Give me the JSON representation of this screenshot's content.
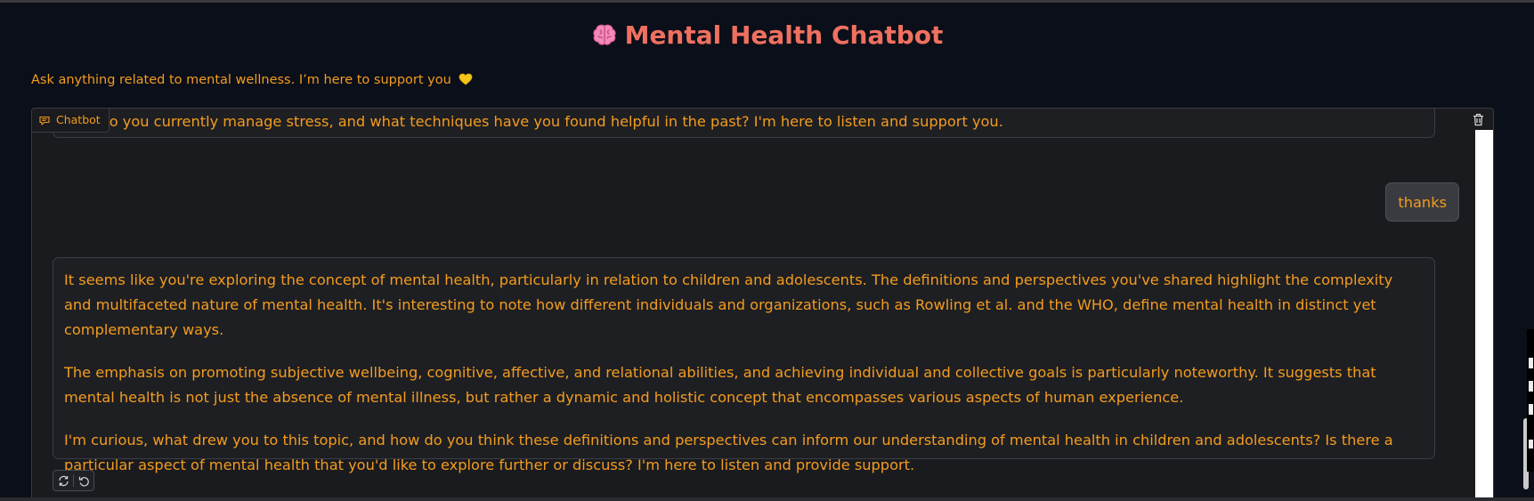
{
  "app": {
    "title": "Mental Health Chatbot",
    "title_icon": "brain-icon",
    "subtitle": "Ask anything related to mental wellness. I’m here to support you",
    "subtitle_icon": "yellow-heart-icon"
  },
  "chatbot": {
    "label": "Chatbot",
    "label_icon": "chat-icon",
    "clear_icon": "trash-icon",
    "messages": [
      {
        "role": "bot",
        "paragraphs": [
          "How do you currently manage stress, and what techniques have you found helpful in the past? I'm here to listen and support you."
        ]
      },
      {
        "role": "user",
        "text": "thanks"
      },
      {
        "role": "bot",
        "paragraphs": [
          "It seems like you're exploring the concept of mental health, particularly in relation to children and adolescents. The definitions and perspectives you've shared highlight the complexity and multifaceted nature of mental health. It's interesting to note how different individuals and organizations, such as Rowling et al. and the WHO, define mental health in distinct yet complementary ways.",
          "The emphasis on promoting subjective wellbeing, cognitive, affective, and relational abilities, and achieving individual and collective goals is particularly noteworthy. It suggests that mental health is not just the absence of mental illness, but rather a dynamic and holistic concept that encompasses various aspects of human experience.",
          "I'm curious, what drew you to this topic, and how do you think these definitions and perspectives can inform our understanding of mental health in children and adolescents? Is there a particular aspect of mental health that you'd like to explore further or discuss? I'm here to listen and provide support."
        ]
      }
    ],
    "actions": [
      {
        "name": "retry-button",
        "icon": "refresh-icon"
      },
      {
        "name": "undo-button",
        "icon": "undo-icon"
      }
    ]
  },
  "colors": {
    "background": "#0b0f19",
    "panel": "#1a1b1f",
    "accent_text": "#f39c1f",
    "title": "#f07060",
    "user_bubble": "#3a3b40"
  }
}
